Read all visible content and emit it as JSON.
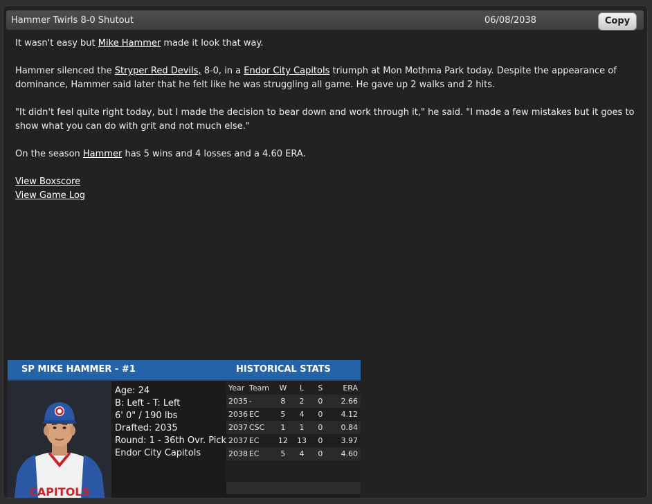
{
  "header": {
    "title": "Hammer Twirls 8-0 Shutout",
    "date": "06/08/2038",
    "copy_label": "Copy"
  },
  "article": {
    "p1": {
      "pre": "It wasn't easy but ",
      "link": "Mike Hammer",
      "post": " made it look that way."
    },
    "p2": {
      "t1": "Hammer silenced the ",
      "l1": "Stryper Red Devils,",
      "t2": " 8-0, in a ",
      "l2": "Endor City Capitols",
      "t3": " triumph at Mon Mothma Park today. Despite the appearance of dominance, Hammer said later that he felt like he was struggling all game. He gave up 2 walks and 2 hits."
    },
    "p3": "\"It didn't feel quite right today, but I made the decision to bear down and work through it,\" he said. \"I made a few mistakes but it goes to show what you can do with grit and not much else.\"",
    "p4": {
      "pre": "On the season ",
      "link": "Hammer",
      "post": " has 5 wins and 4 losses and a 4.60 ERA."
    },
    "links": {
      "boxscore": "View Boxscore",
      "gamelog": "View Game Log"
    }
  },
  "player_card": {
    "header": "SP MIKE HAMMER - #1",
    "stats_header": "HISTORICAL STATS",
    "bio": {
      "age": "Age: 24",
      "bats_throws": "B: Left - T: Left",
      "size": "6' 0\" / 190 lbs",
      "drafted": "Drafted: 2035",
      "round": "Round: 1 - 36th Ovr. Pick",
      "team": "Endor City Capitols"
    },
    "jersey_text": "CAPITOLS",
    "columns": [
      "Year",
      "Team",
      "W",
      "L",
      "S",
      "ERA"
    ],
    "rows": [
      [
        "2035",
        "-",
        "8",
        "2",
        "0",
        "2.66"
      ],
      [
        "2036",
        "EC",
        "5",
        "4",
        "0",
        "4.12"
      ],
      [
        "2037",
        "CSC",
        "1",
        "1",
        "0",
        "0.84"
      ],
      [
        "2037",
        "EC",
        "12",
        "13",
        "0",
        "3.97"
      ],
      [
        "2038",
        "EC",
        "5",
        "4",
        "0",
        "4.60"
      ]
    ]
  },
  "colors": {
    "card_header": "#2563a8",
    "background": "#222222"
  }
}
